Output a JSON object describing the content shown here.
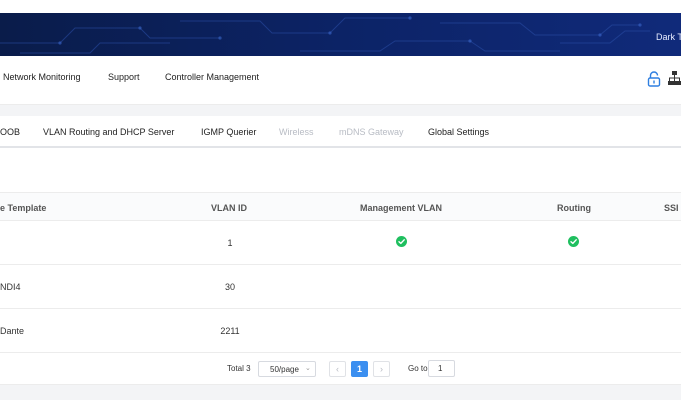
{
  "header": {
    "banner_text": "Dark T"
  },
  "menu": {
    "items": [
      "Network Monitoring",
      "Support",
      "Controller Management"
    ]
  },
  "tabs": [
    {
      "label": "OOB",
      "disabled": false
    },
    {
      "label": "VLAN Routing and DHCP Server",
      "disabled": false
    },
    {
      "label": "IGMP Querier",
      "disabled": false
    },
    {
      "label": "Wireless",
      "disabled": true
    },
    {
      "label": "mDNS Gateway",
      "disabled": true
    },
    {
      "label": "Global Settings",
      "disabled": false
    }
  ],
  "table": {
    "columns": [
      "e Template",
      "VLAN ID",
      "Management VLAN",
      "Routing",
      "SSI"
    ],
    "rows": [
      {
        "name": "",
        "vlan_id": "1",
        "management_vlan": true,
        "routing": true
      },
      {
        "name": "NDI4",
        "vlan_id": "30",
        "management_vlan": false,
        "routing": false
      },
      {
        "name": "Dante",
        "vlan_id": "2211",
        "management_vlan": false,
        "routing": false
      }
    ]
  },
  "pagination": {
    "total": "Total 3",
    "page_size": "50/page",
    "prev": "‹",
    "current_page": "1",
    "next": "›",
    "goto_label": "Go to",
    "goto_value": "1"
  },
  "icons": [
    "lock-icon",
    "topology-icon",
    "check-icon"
  ],
  "colors": {
    "banner": "#0c2366",
    "accent": "#3b8ff0",
    "success": "#1fbf5f",
    "icon_blue": "#2f7fe0"
  }
}
